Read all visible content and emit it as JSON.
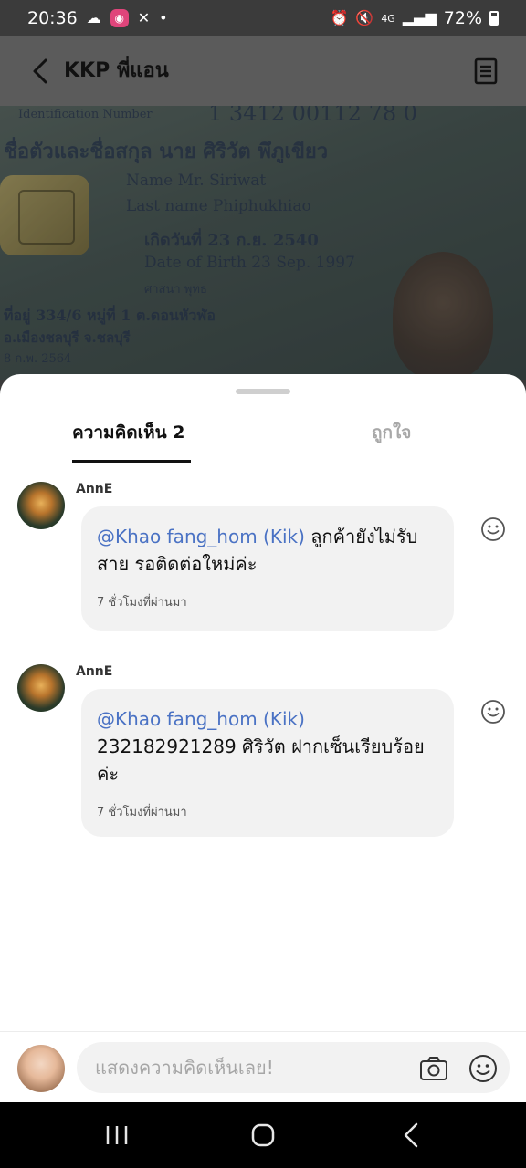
{
  "status_bar": {
    "time": "20:36",
    "network": "4G",
    "battery": "72%"
  },
  "header": {
    "title": "KKP พี่แอน"
  },
  "photo": {
    "id_number": "1 3412 00112 78 0",
    "line_id_label": "Identification Number",
    "line_name_th": "ชื่อตัวและชื่อสกุล นาย ศิริวัต พึภูเขียว",
    "line_name_en": "Name  Mr. Siriwat",
    "line_last_en": "Last name  Phiphukhiao",
    "line_dob_th": "เกิดวันที่  23 ก.ย. 2540",
    "line_dob_en": "Date of Birth  23 Sep. 1997",
    "line_religion": "ศาสนา  พุทธ",
    "line_addr1": "ที่อยู่ 334/6 หมู่ที่ 1 ต.ดอนหัวฬ่อ",
    "line_addr2": "อ.เมืองชลบุรี จ.ชลบุรี",
    "line_issue": "8 ก.พ. 2564"
  },
  "tabs": {
    "comments_label": "ความคิดเห็น 2",
    "likes_label": "ถูกใจ"
  },
  "comments": [
    {
      "author": "AnnE",
      "mention": "@Khao fang_hom (Kik)",
      "text": " ลูกค้ายังไม่รับสาย รอติดต่อใหม่ค่ะ",
      "time": "7 ชั่วโมงที่ผ่านมา"
    },
    {
      "author": "AnnE",
      "mention": "@Khao fang_hom (Kik)",
      "text": "232182921289 ศิริวัต ฝากเซ็นเรียบร้อยค่ะ",
      "time": "7 ชั่วโมงที่ผ่านมา"
    }
  ],
  "composer": {
    "placeholder": "แสดงความคิดเห็นเลย!"
  },
  "colors": {
    "mention": "#4a72c4",
    "bubble": "#f2f2f2",
    "header_dim": "#5b5b5b"
  },
  "icons": {
    "back": "chevron-left-icon",
    "document": "document-icon",
    "react": "smiley-icon",
    "camera": "camera-icon",
    "emoji": "smiley-icon"
  }
}
